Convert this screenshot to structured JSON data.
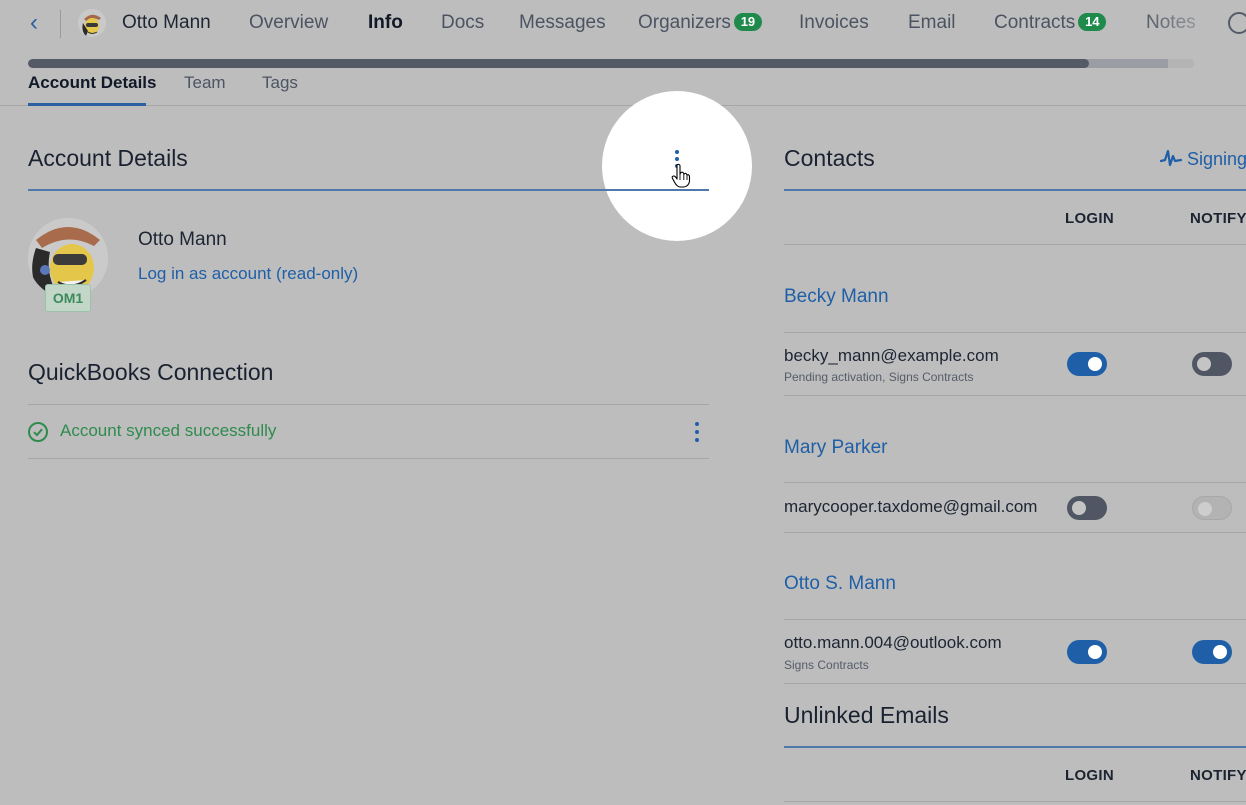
{
  "nav": {
    "account_name": "Otto Mann",
    "tabs": [
      {
        "label": "Overview",
        "badge": ""
      },
      {
        "label": "Info",
        "badge": ""
      },
      {
        "label": "Docs",
        "badge": ""
      },
      {
        "label": "Messages",
        "badge": ""
      },
      {
        "label": "Organizers",
        "badge": "19"
      },
      {
        "label": "Invoices",
        "badge": ""
      },
      {
        "label": "Email",
        "badge": ""
      },
      {
        "label": "Contracts",
        "badge": "14"
      },
      {
        "label": "Notes",
        "badge": ""
      }
    ],
    "active_tab": "Info",
    "progress": 0.91
  },
  "subtabs": [
    "Account Details",
    "Team",
    "Tags"
  ],
  "account_details": {
    "heading": "Account Details",
    "name": "Otto Mann",
    "tag": "OM1",
    "login_link": "Log in as account (read-only)"
  },
  "quickbooks": {
    "heading": "QuickBooks Connection",
    "status": "Account synced successfully"
  },
  "contacts": {
    "heading": "Contacts",
    "signing_label": "Signing",
    "col_login": "LOGIN",
    "col_notify": "NOTIFY",
    "items": [
      {
        "name": "Becky Mann",
        "email": "becky_mann@example.com",
        "sub": "Pending activation, Signs Contracts",
        "login": "on",
        "notify": "off"
      },
      {
        "name": "Mary Parker",
        "email": "marycooper.taxdome@gmail.com",
        "sub": "",
        "login": "off",
        "notify": "disabled"
      },
      {
        "name": "Otto S. Mann",
        "email": "otto.mann.004@outlook.com",
        "sub": "Signs Contracts",
        "login": "on",
        "notify": "on"
      }
    ]
  },
  "unlinked": {
    "heading": "Unlinked Emails",
    "col_login": "LOGIN",
    "col_notify": "NOTIFY"
  },
  "colors": {
    "accent": "#1f5fa7",
    "success": "#2f8b4e",
    "badge": "#1f8a4c"
  }
}
